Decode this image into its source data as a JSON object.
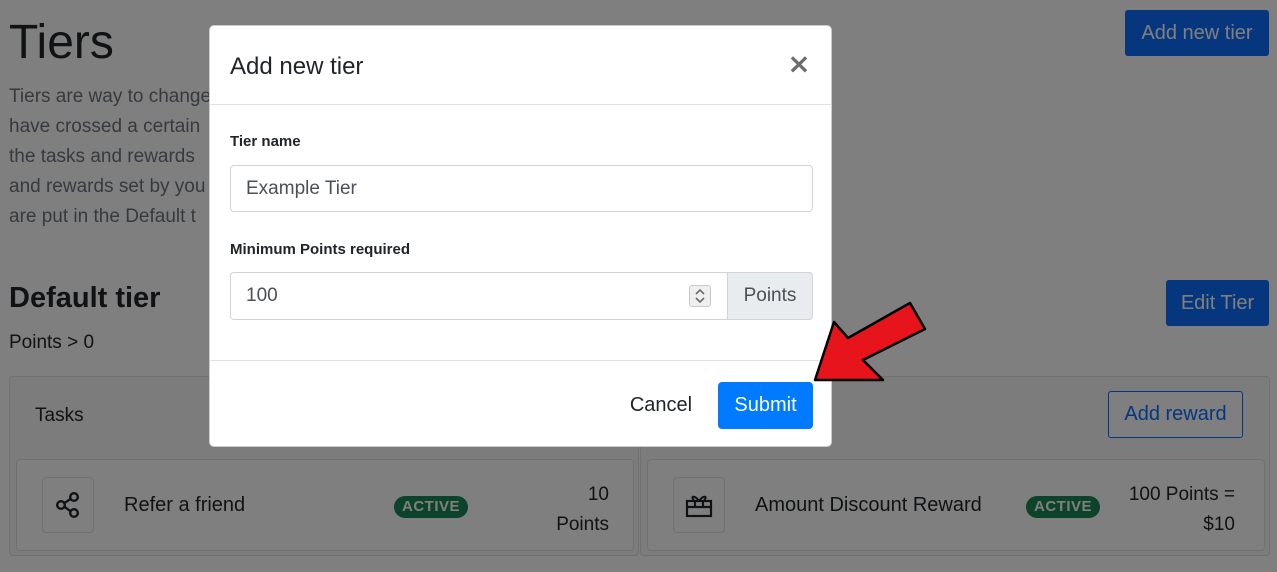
{
  "page": {
    "title": "Tiers",
    "add_tier_label": "Add new tier",
    "intro_lines": [
      "Tiers are way to change",
      "have crossed a certain",
      "the tasks and rewards",
      "and rewards set by you",
      "are put in the Default t"
    ],
    "default_tier": {
      "title": "Default tier",
      "rule": "Points > 0",
      "edit_label": "Edit Tier"
    },
    "tasks_panel": {
      "header": "Tasks",
      "item": {
        "icon": "share-icon",
        "name": "Refer a friend",
        "status": "ACTIVE",
        "value_lines": [
          "10",
          "Points"
        ]
      }
    },
    "rewards_panel": {
      "add_reward_label": "Add reward",
      "item": {
        "icon": "gift-icon",
        "name": "Amount Discount Reward",
        "status": "ACTIVE",
        "value_lines": [
          "100 Points =",
          "$10"
        ]
      }
    }
  },
  "modal": {
    "title": "Add new tier",
    "close_glyph": "×",
    "tier_name_label": "Tier name",
    "tier_name_value": "Example Tier",
    "min_points_label": "Minimum Points required",
    "min_points_value": "100",
    "points_addon": "Points",
    "cancel_label": "Cancel",
    "submit_label": "Submit"
  },
  "colors": {
    "primary": "#0d6efd",
    "submit": "#007bff",
    "active_badge": "#198754",
    "annotation_arrow": "#e8141c"
  }
}
